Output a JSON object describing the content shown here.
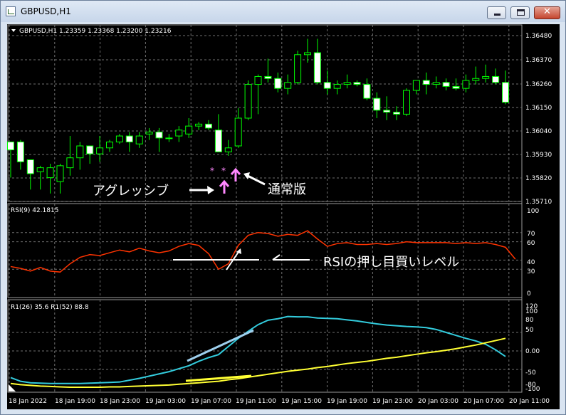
{
  "window": {
    "title": "GBPUSD,H1",
    "icon": "chart-window-icon",
    "buttons": {
      "minimize": "minimize-icon",
      "maximize": "maximize-icon",
      "close": "close-icon"
    }
  },
  "price_panel": {
    "header": "GBPUSD,H1  1.23359 1.23368 1.23200 1.23216",
    "labels": [
      "1.36480",
      "1.36370",
      "1.36260",
      "1.36150",
      "1.36040",
      "1.35930",
      "1.35820",
      "1.35710"
    ],
    "annotations": {
      "agressive": "アグレッシブ",
      "normal": "通常版"
    }
  },
  "rsi_panel": {
    "header": "RSI(9) 42.1815",
    "labels": [
      "100",
      "70",
      "60",
      "40",
      "30",
      "0"
    ],
    "annotation": "RSIの押し目買いレベル"
  },
  "r1_panel": {
    "header": "R1(26) 35.6  R1(52) 88.8",
    "labels": [
      "120",
      "100",
      "80",
      "50",
      "0.00",
      "-50",
      "-80",
      "-100"
    ]
  },
  "time_axis": [
    "18 Jan 2022",
    "18 Jan 19:00",
    "18 Jan 23:00",
    "19 Jan 03:00",
    "19 Jan 07:00",
    "19 Jan 11:00",
    "19 Jan 15:00",
    "19 Jan 19:00",
    "19 Jan 23:00",
    "20 Jan 03:00",
    "20 Jan 07:00",
    "20 Jan 11:00"
  ],
  "colors": {
    "background": "#000000",
    "bull_candle": "#000000",
    "bear_candle": "#ffffff",
    "wick": "#00ff00",
    "rsi_line": "#ff3300",
    "r1_fast": "#33ccdd",
    "r1_slow": "#ffff33",
    "arrow": "#ff88ff",
    "grid": "#707070"
  },
  "chart_data": [
    {
      "type": "candlestick",
      "title": "GBPUSD,H1",
      "ylim": [
        1.3566,
        1.3655
      ],
      "candles": [
        {
          "o": 1.3596,
          "h": 1.3596,
          "l": 1.3578,
          "c": 1.3592
        },
        {
          "o": 1.3596,
          "h": 1.3597,
          "l": 1.3582,
          "c": 1.3586
        },
        {
          "o": 1.3587,
          "h": 1.3587,
          "l": 1.3572,
          "c": 1.358
        },
        {
          "o": 1.3581,
          "h": 1.3584,
          "l": 1.3572,
          "c": 1.3583
        },
        {
          "o": 1.3578,
          "h": 1.3585,
          "l": 1.357,
          "c": 1.3583
        },
        {
          "o": 1.3576,
          "h": 1.3585,
          "l": 1.357,
          "c": 1.3584
        },
        {
          "o": 1.3583,
          "h": 1.3599,
          "l": 1.3579,
          "c": 1.3588
        },
        {
          "o": 1.3588,
          "h": 1.3596,
          "l": 1.3582,
          "c": 1.3594
        },
        {
          "o": 1.3594,
          "h": 1.3594,
          "l": 1.3585,
          "c": 1.359
        },
        {
          "o": 1.359,
          "h": 1.3599,
          "l": 1.3586,
          "c": 1.3593
        },
        {
          "o": 1.3593,
          "h": 1.3597,
          "l": 1.3591,
          "c": 1.3596
        },
        {
          "o": 1.3596,
          "h": 1.36,
          "l": 1.3595,
          "c": 1.3599
        },
        {
          "o": 1.3599,
          "h": 1.3601,
          "l": 1.3591,
          "c": 1.3596
        },
        {
          "o": 1.3595,
          "h": 1.3601,
          "l": 1.3593,
          "c": 1.3599
        },
        {
          "o": 1.36,
          "h": 1.3603,
          "l": 1.3597,
          "c": 1.3601
        },
        {
          "o": 1.3601,
          "h": 1.3603,
          "l": 1.3591,
          "c": 1.3598
        },
        {
          "o": 1.3598,
          "h": 1.36,
          "l": 1.3596,
          "c": 1.3598
        },
        {
          "o": 1.3599,
          "h": 1.3604,
          "l": 1.3596,
          "c": 1.3602
        },
        {
          "o": 1.36,
          "h": 1.3608,
          "l": 1.3598,
          "c": 1.3604
        },
        {
          "o": 1.3604,
          "h": 1.3606,
          "l": 1.3602,
          "c": 1.3605
        },
        {
          "o": 1.3605,
          "h": 1.3607,
          "l": 1.3602,
          "c": 1.3603
        },
        {
          "o": 1.3602,
          "h": 1.361,
          "l": 1.3599,
          "c": 1.3591
        },
        {
          "o": 1.3591,
          "h": 1.3597,
          "l": 1.3589,
          "c": 1.3593
        },
        {
          "o": 1.3594,
          "h": 1.3613,
          "l": 1.3593,
          "c": 1.3608
        },
        {
          "o": 1.3608,
          "h": 1.3627,
          "l": 1.3607,
          "c": 1.3625
        },
        {
          "o": 1.3625,
          "h": 1.363,
          "l": 1.361,
          "c": 1.3629
        },
        {
          "o": 1.3629,
          "h": 1.3638,
          "l": 1.3626,
          "c": 1.3628
        },
        {
          "o": 1.3628,
          "h": 1.3631,
          "l": 1.3621,
          "c": 1.3623
        },
        {
          "o": 1.3623,
          "h": 1.363,
          "l": 1.362,
          "c": 1.3626
        },
        {
          "o": 1.3626,
          "h": 1.3642,
          "l": 1.3625,
          "c": 1.364
        },
        {
          "o": 1.364,
          "h": 1.3648,
          "l": 1.3636,
          "c": 1.3641
        },
        {
          "o": 1.3641,
          "h": 1.3648,
          "l": 1.3625,
          "c": 1.3626
        },
        {
          "o": 1.3626,
          "h": 1.3632,
          "l": 1.362,
          "c": 1.3623
        },
        {
          "o": 1.3623,
          "h": 1.3627,
          "l": 1.362,
          "c": 1.3625
        },
        {
          "o": 1.3625,
          "h": 1.363,
          "l": 1.3623,
          "c": 1.3626
        },
        {
          "o": 1.3626,
          "h": 1.3627,
          "l": 1.3624,
          "c": 1.3625
        },
        {
          "o": 1.3625,
          "h": 1.3628,
          "l": 1.3617,
          "c": 1.3618
        },
        {
          "o": 1.3618,
          "h": 1.3621,
          "l": 1.3608,
          "c": 1.3612
        },
        {
          "o": 1.3612,
          "h": 1.3619,
          "l": 1.3607,
          "c": 1.3611
        },
        {
          "o": 1.3611,
          "h": 1.3614,
          "l": 1.3607,
          "c": 1.361
        },
        {
          "o": 1.361,
          "h": 1.3623,
          "l": 1.3609,
          "c": 1.3622
        },
        {
          "o": 1.3622,
          "h": 1.3627,
          "l": 1.362,
          "c": 1.3627
        },
        {
          "o": 1.3627,
          "h": 1.3631,
          "l": 1.362,
          "c": 1.3625
        },
        {
          "o": 1.3625,
          "h": 1.3629,
          "l": 1.3623,
          "c": 1.3626
        },
        {
          "o": 1.3626,
          "h": 1.3628,
          "l": 1.3622,
          "c": 1.3624
        },
        {
          "o": 1.3624,
          "h": 1.3628,
          "l": 1.3622,
          "c": 1.3623
        },
        {
          "o": 1.3623,
          "h": 1.363,
          "l": 1.3621,
          "c": 1.3627
        },
        {
          "o": 1.3627,
          "h": 1.3634,
          "l": 1.3625,
          "c": 1.3628
        },
        {
          "o": 1.3628,
          "h": 1.3635,
          "l": 1.3626,
          "c": 1.3629
        },
        {
          "o": 1.3629,
          "h": 1.3633,
          "l": 1.3625,
          "c": 1.3626
        },
        {
          "o": 1.3626,
          "h": 1.3632,
          "l": 1.3615,
          "c": 1.3616
        }
      ]
    },
    {
      "type": "line",
      "title": "RSI(9) 42.1815",
      "ylim": [
        0,
        100
      ],
      "series": [
        {
          "name": "RSI(9)",
          "values": [
            33,
            31,
            28,
            32,
            28,
            27,
            36,
            43,
            46,
            45,
            48,
            51,
            49,
            53,
            50,
            48,
            50,
            55,
            58,
            56,
            47,
            30,
            36,
            56,
            67,
            70,
            69,
            66,
            68,
            67,
            72,
            63,
            55,
            58,
            59,
            57,
            57,
            58,
            57,
            58,
            60,
            59,
            59,
            59,
            59,
            58,
            59,
            58,
            59,
            57,
            54,
            41
          ]
        }
      ]
    },
    {
      "type": "line",
      "title": "R1(26) 35.6  R1(52) 88.8",
      "ylim": [
        -100,
        100
      ],
      "series": [
        {
          "name": "R1(26)",
          "values": [
            -72,
            -82,
            -86,
            -87,
            -88,
            -88,
            -88,
            -88,
            -87,
            -86,
            -85,
            -84,
            -79,
            -74,
            -68,
            -62,
            -56,
            -48,
            -40,
            -28,
            -18,
            -10,
            12,
            34,
            53,
            71,
            83,
            87,
            93,
            92,
            92,
            89,
            88,
            87,
            84,
            81,
            77,
            73,
            70,
            68,
            66,
            65,
            63,
            58,
            50,
            42,
            34,
            27,
            18,
            3,
            -15
          ]
        },
        {
          "name": "R1(52)",
          "values": [
            -88,
            -91,
            -93,
            -95,
            -96,
            -97,
            -98,
            -98,
            -98,
            -98,
            -97,
            -97,
            -96,
            -95,
            -94,
            -93,
            -92,
            -90,
            -88,
            -86,
            -84,
            -82,
            -78,
            -75,
            -71,
            -67,
            -63,
            -59,
            -55,
            -52,
            -49,
            -45,
            -42,
            -38,
            -34,
            -31,
            -28,
            -24,
            -20,
            -17,
            -13,
            -9,
            -5,
            -2,
            2,
            6,
            11,
            16,
            22,
            28,
            34
          ]
        }
      ]
    }
  ]
}
